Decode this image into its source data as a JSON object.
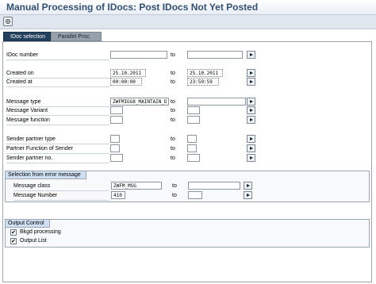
{
  "title": "Manual Processing of IDocs: Post IDocs Not Yet Posted",
  "toolbar": {
    "execute_icon": "execute-icon"
  },
  "tabs": [
    {
      "label": "IDoc selection",
      "active": true
    },
    {
      "label": "Parallel Proc.",
      "active": false
    }
  ],
  "rows": {
    "idoc_number": {
      "label": "IDoc number",
      "to": "to",
      "from_value": "",
      "to_value": ""
    },
    "created_on": {
      "label": "Created on",
      "to": "to",
      "from_value": "25.10.2011",
      "to_value": "25.10.2011"
    },
    "created_at": {
      "label": "Created at",
      "to": "to",
      "from_value": "00:00:00",
      "to_value": "23:59:59"
    },
    "message_type": {
      "label": "Message type",
      "to": "to",
      "from_value": "ZWFMIGG8_MAINTAIN_D",
      "to_value": ""
    },
    "message_variant": {
      "label": "Message Variant",
      "to": "to",
      "from_value": "",
      "to_value": ""
    },
    "message_function": {
      "label": "Message function",
      "to": "to",
      "from_value": "",
      "to_value": ""
    },
    "sender_partner_type": {
      "label": "Sender partner type",
      "to": "to",
      "from_value": "",
      "to_value": ""
    },
    "partner_function_sender": {
      "label": "Partner Function of Sender",
      "to": "to",
      "from_value": "",
      "to_value": ""
    },
    "sender_partner_no": {
      "label": "Sender partner no.",
      "to": "to",
      "from_value": "",
      "to_value": ""
    }
  },
  "error_group": {
    "title": "Selection from error message",
    "message_class": {
      "label": "Message class",
      "to": "to",
      "from_value": "ZWFM_MSG",
      "to_value": ""
    },
    "message_number": {
      "label": "Message Number",
      "to": "to",
      "from_value": "410",
      "to_value": ""
    }
  },
  "output_group": {
    "title": "Output Control",
    "bkgd": {
      "label": "Bkgd processing",
      "checked": true
    },
    "output_list": {
      "label": "Output List",
      "checked": true
    }
  },
  "check_mark": "✔"
}
